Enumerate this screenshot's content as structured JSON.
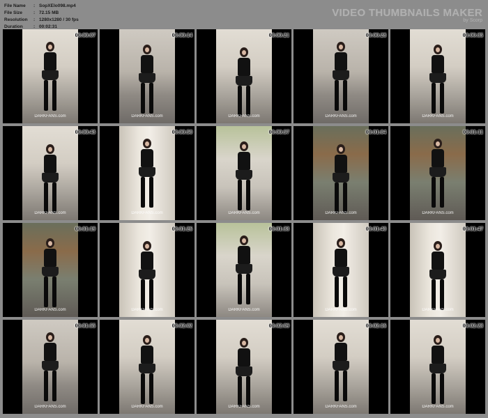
{
  "file_info": {
    "name_label": "File Name",
    "name_value": "SopXElo098.mp4",
    "size_label": "File Size",
    "size_value": "72.15 MB",
    "resolution_label": "Resolution",
    "resolution_value": "1280x1280 / 30 fps",
    "duration_label": "Duration",
    "duration_value": "00:02:31",
    "separator": ":"
  },
  "brand": {
    "title": "VIDEO THUMBNAILS MAKER",
    "subtitle": "by Scorp"
  },
  "watermark": "DARKFANS.com",
  "thumbnails": [
    {
      "time": "00:00:07",
      "scene": "wall"
    },
    {
      "time": "00:00:14",
      "scene": "plain"
    },
    {
      "time": "00:00:21",
      "scene": "wall"
    },
    {
      "time": "00:00:28",
      "scene": "plain"
    },
    {
      "time": "00:00:35",
      "scene": "wall"
    },
    {
      "time": "00:00:43",
      "scene": "wall"
    },
    {
      "time": "00:00:50",
      "scene": "column"
    },
    {
      "time": "00:00:57",
      "scene": "tree"
    },
    {
      "time": "00:01:04",
      "scene": "graffiti"
    },
    {
      "time": "00:01:11",
      "scene": "graffiti"
    },
    {
      "time": "00:01:19",
      "scene": "graffiti"
    },
    {
      "time": "00:01:26",
      "scene": "column"
    },
    {
      "time": "00:01:33",
      "scene": "tree"
    },
    {
      "time": "00:01:40",
      "scene": "column"
    },
    {
      "time": "00:01:47",
      "scene": "column"
    },
    {
      "time": "00:01:55",
      "scene": "plain"
    },
    {
      "time": "00:02:02",
      "scene": "wall"
    },
    {
      "time": "00:02:09",
      "scene": "wall"
    },
    {
      "time": "00:02:16",
      "scene": "wall"
    },
    {
      "time": "00:02:23",
      "scene": "wall"
    }
  ]
}
